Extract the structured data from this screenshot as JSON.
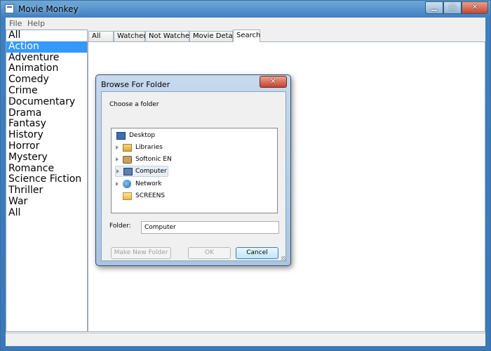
{
  "window": {
    "title": "Movie Monkey",
    "close_glyph": "✕"
  },
  "menu": [
    {
      "label": "File"
    },
    {
      "label": "Help"
    }
  ],
  "genres": [
    {
      "label": "All"
    },
    {
      "label": "Action"
    },
    {
      "label": "Adventure"
    },
    {
      "label": "Animation"
    },
    {
      "label": "Comedy"
    },
    {
      "label": "Crime"
    },
    {
      "label": "Documentary"
    },
    {
      "label": "Drama"
    },
    {
      "label": "Fantasy"
    },
    {
      "label": "History"
    },
    {
      "label": "Horror"
    },
    {
      "label": "Mystery"
    },
    {
      "label": "Romance"
    },
    {
      "label": "Science Fiction"
    },
    {
      "label": "Thriller"
    },
    {
      "label": "War"
    },
    {
      "label": "All"
    }
  ],
  "selected_genre": "Action",
  "tabs": [
    {
      "label": "All"
    },
    {
      "label": "Watched"
    },
    {
      "label": "Not Watched"
    },
    {
      "label": "Movie Details"
    },
    {
      "label": "Search"
    }
  ],
  "active_tab": "Search",
  "dialog": {
    "title": "Browse For Folder",
    "close_glyph": "✕",
    "prompt": "Choose a folder",
    "tree": [
      {
        "label": "Desktop",
        "icon": "desktop-icon"
      },
      {
        "label": "Libraries",
        "icon": "libraries-icon"
      },
      {
        "label": "Softonic EN",
        "icon": "user-folder-icon"
      },
      {
        "label": "Computer",
        "icon": "computer-icon"
      },
      {
        "label": "Network",
        "icon": "network-icon"
      },
      {
        "label": "SCREENS",
        "icon": "folder-icon"
      }
    ],
    "selected_node": "Computer",
    "folder_label": "Folder:",
    "folder_value": "Computer",
    "buttons": {
      "make_new_folder": "Make New Folder",
      "ok": "OK",
      "cancel": "Cancel"
    }
  }
}
